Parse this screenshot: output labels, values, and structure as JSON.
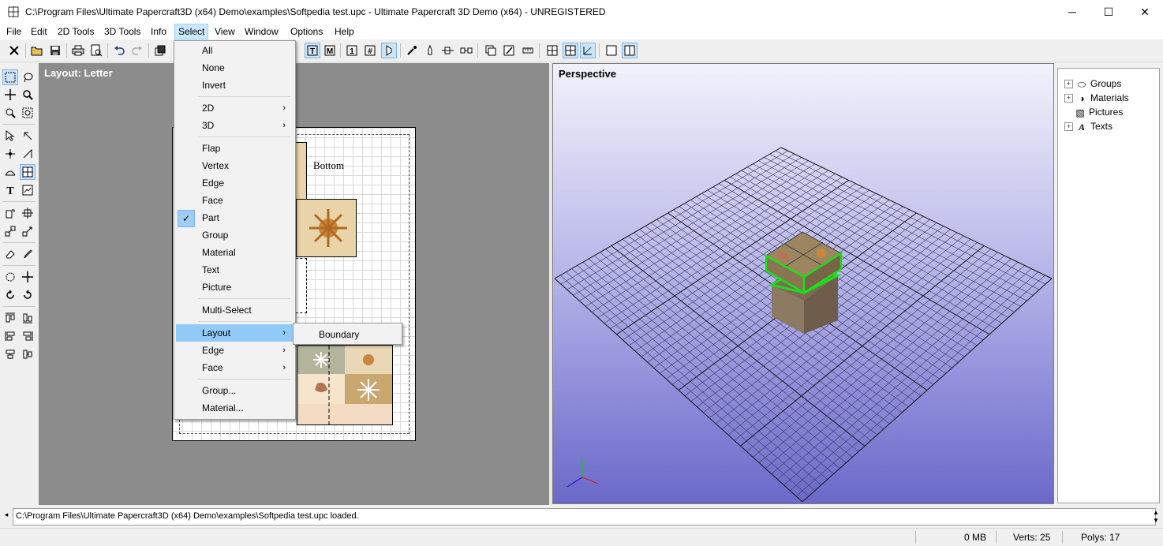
{
  "window": {
    "title": "C:\\Program Files\\Ultimate Papercraft3D (x64) Demo\\examples\\Softpedia test.upc - Ultimate Papercraft 3D Demo (x64) - UNREGISTERED",
    "minimize": "─",
    "maximize": "☐",
    "close": "✕"
  },
  "menubar": [
    "File",
    "Edit",
    "2D Tools",
    "3D Tools",
    "Info",
    "Select",
    "View",
    "Window",
    "Options",
    "Help"
  ],
  "select_menu": {
    "items": [
      "All",
      "None",
      "Invert",
      "2D",
      "3D",
      "Flap",
      "Vertex",
      "Edge",
      "Face",
      "Part",
      "Group",
      "Material",
      "Text",
      "Picture",
      "Multi-Select",
      "Layout",
      "Edge",
      "Face",
      "Group...",
      "Material..."
    ],
    "checked": "Part",
    "highlighted": "Layout",
    "submenu_arrow": "›",
    "checkmark": "✓"
  },
  "layout_submenu": [
    "Boundary"
  ],
  "layout_view": {
    "title": "Layout: Letter",
    "bottom_label": "Bottom"
  },
  "perspective_view": {
    "title": "Perspective"
  },
  "tree": [
    "Groups",
    "Materials",
    "Pictures",
    "Texts"
  ],
  "tree_expander": "+",
  "log": "C:\\Program Files\\Ultimate Papercraft3D (x64) Demo\\examples\\Softpedia test.upc loaded.",
  "status": {
    "memory": "0 MB",
    "verts": "Verts: 25",
    "polys": "Polys: 17"
  },
  "colors": {
    "perspective_top": "#f2f2fb",
    "perspective_bottom": "#6b69c8",
    "menu_highlight": "#91c9f7",
    "selection_green": "#19e019"
  }
}
